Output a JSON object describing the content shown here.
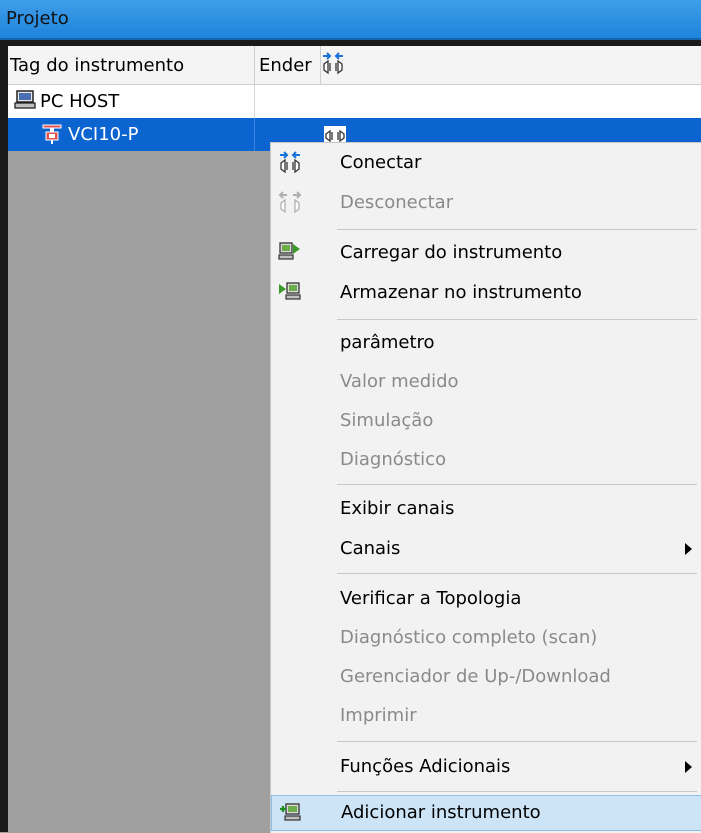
{
  "window": {
    "title": "Projeto"
  },
  "tree": {
    "columns": [
      "Tag do instrumento",
      "Ender"
    ],
    "rows": [
      {
        "label": "PC HOST",
        "icon": "computer-icon",
        "selected": false
      },
      {
        "label": "VCI10-P",
        "icon": "instrument-icon",
        "selected": true
      }
    ]
  },
  "context_menu": {
    "items": [
      {
        "label": "Conectar",
        "icon": "connect-icon",
        "enabled": true
      },
      {
        "label": "Desconectar",
        "icon": "disconnect-icon",
        "enabled": false
      },
      {
        "label": "Carregar do instrumento",
        "icon": "upload-icon",
        "enabled": true
      },
      {
        "label": "Armazenar no instrumento",
        "icon": "download-icon",
        "enabled": true
      },
      {
        "label": "parâmetro",
        "enabled": true
      },
      {
        "label": "Valor medido",
        "enabled": false
      },
      {
        "label": "Simulação",
        "enabled": false
      },
      {
        "label": "Diagnóstico",
        "enabled": false
      },
      {
        "label": "Exibir canais",
        "enabled": true
      },
      {
        "label": "Canais",
        "enabled": true,
        "submenu": true
      },
      {
        "label": "Verificar a Topologia",
        "enabled": true
      },
      {
        "label": "Diagnóstico completo (scan)",
        "enabled": false
      },
      {
        "label": "Gerenciador de Up-/Download",
        "enabled": false
      },
      {
        "label": "Imprimir",
        "enabled": false
      },
      {
        "label": "Funções Adicionais",
        "enabled": true,
        "submenu": true
      },
      {
        "label": "Adicionar instrumento",
        "icon": "add-instrument-icon",
        "enabled": true,
        "highlighted": true
      }
    ]
  },
  "colors": {
    "title_bar": "#1e84dc",
    "selection": "#0b64d0",
    "menu_highlight": "#cde4f7"
  }
}
